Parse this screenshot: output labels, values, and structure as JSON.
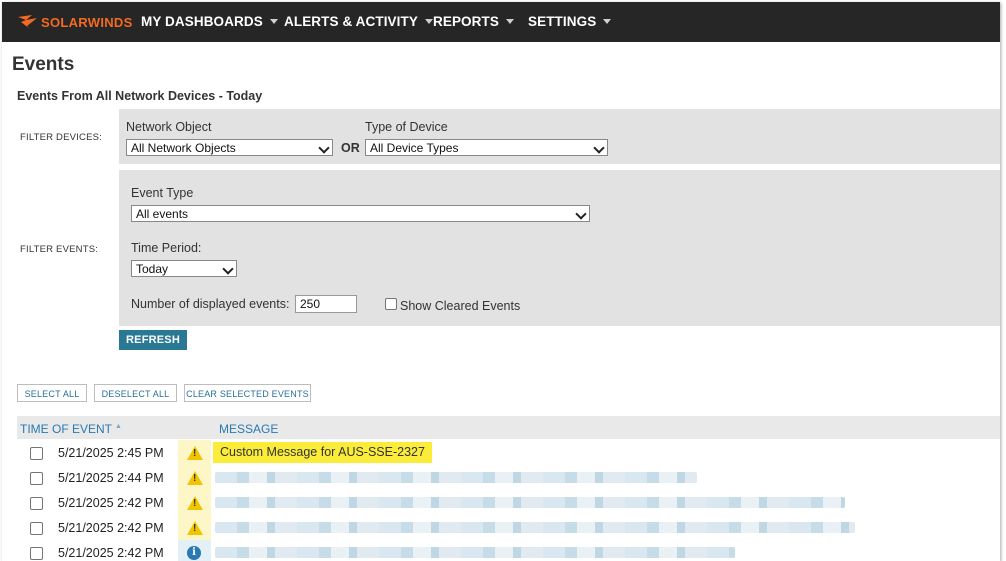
{
  "nav": {
    "logo": "SOLARWINDS",
    "items": [
      {
        "label": "MY DASHBOARDS"
      },
      {
        "label": "ALERTS & ACTIVITY"
      },
      {
        "label": "REPORTS"
      },
      {
        "label": "SETTINGS"
      }
    ]
  },
  "page": {
    "title": "Events",
    "subtitle": "Events From All Network Devices - Today"
  },
  "filter_devices": {
    "label": "FILTER DEVICES:",
    "network_object_label": "Network Object",
    "network_object_value": "All Network Objects",
    "or_label": "OR",
    "device_type_label": "Type of Device",
    "device_type_value": "All Device Types"
  },
  "filter_events": {
    "label": "FILTER EVENTS:",
    "event_type_label": "Event Type",
    "event_type_value": "All events",
    "time_period_label": "Time Period:",
    "time_period_value": "Today",
    "num_events_label": "Number of displayed events:",
    "num_events_value": "250",
    "show_cleared_label": "Show Cleared Events",
    "show_cleared_checked": false
  },
  "buttons": {
    "refresh": "REFRESH",
    "select_all": "SELECT ALL",
    "deselect_all": "DESELECT ALL",
    "clear_selected": "CLEAR SELECTED EVENTS"
  },
  "table": {
    "columns": {
      "time": "TIME OF EVENT",
      "message": "MESSAGE"
    },
    "rows": [
      {
        "time": "5/21/2025 2:45 PM",
        "severity": "warning-icon",
        "message": "Custom Message for AUS-SSE-2327"
      },
      {
        "time": "5/21/2025 2:44 PM",
        "severity": "warning-icon",
        "message": ""
      },
      {
        "time": "5/21/2025 2:42 PM",
        "severity": "warning-icon",
        "message": ""
      },
      {
        "time": "5/21/2025 2:42 PM",
        "severity": "warning-icon",
        "message": ""
      },
      {
        "time": "5/21/2025 2:42 PM",
        "severity": "info-icon",
        "message": ""
      }
    ]
  },
  "colors": {
    "nav_bg": "#262626",
    "brand_orange": "#f36a21",
    "refresh_bg": "#297994",
    "link_blue": "#2a79b0",
    "highlight_yellow": "#fbec39",
    "warning_yellow": "#f2c400"
  }
}
